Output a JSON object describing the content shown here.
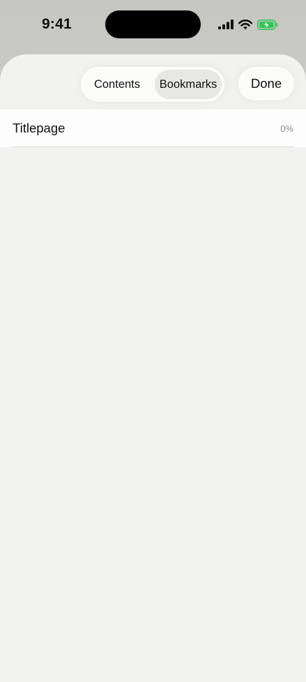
{
  "status_bar": {
    "time": "9:41",
    "icons": [
      "cellular-signal-icon",
      "wifi-icon",
      "battery-charging-icon"
    ],
    "battery_color": "#34c759"
  },
  "header": {
    "segments": [
      {
        "label": "Contents",
        "selected": false
      },
      {
        "label": "Bookmarks",
        "selected": true
      }
    ],
    "done_label": "Done"
  },
  "bookmarks": [
    {
      "title": "Titlepage",
      "progress": "0%"
    }
  ],
  "colors": {
    "sheet_background": "#f2f3f1",
    "row_background": "#fcfdfc",
    "selected_segment": "#e7e7e5",
    "secondary_text": "#8a8a8a"
  }
}
